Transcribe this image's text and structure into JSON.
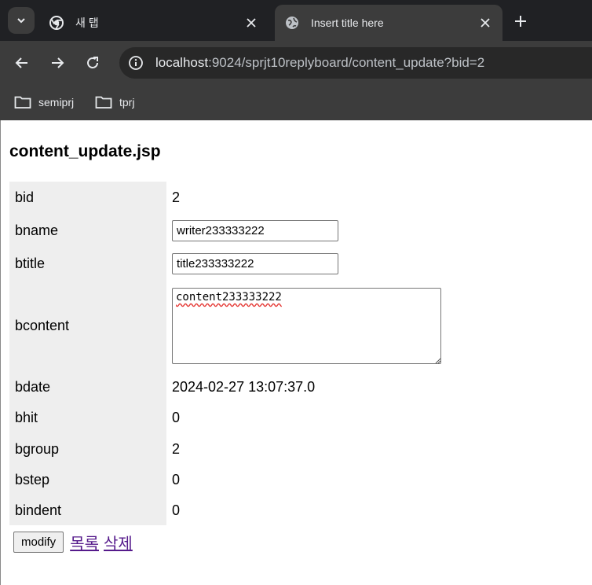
{
  "browser": {
    "tabs": [
      {
        "title": "새 탭",
        "active": false
      },
      {
        "title": "Insert title here",
        "active": true
      }
    ],
    "address": {
      "host": "localhost",
      "rest": ":9024/sprjt10replyboard/content_update?bid=2"
    },
    "bookmarks": [
      {
        "label": "semiprj"
      },
      {
        "label": "tprj"
      }
    ]
  },
  "page": {
    "heading": "content_update.jsp",
    "fields": {
      "bid": {
        "label": "bid",
        "value": "2"
      },
      "bname": {
        "label": "bname",
        "value": "writer233333222"
      },
      "btitle": {
        "label": "btitle",
        "value": "title233333222"
      },
      "bcontent": {
        "label": "bcontent",
        "value": "content233333222"
      },
      "bdate": {
        "label": "bdate",
        "value": "2024-02-27 13:07:37.0"
      },
      "bhit": {
        "label": "bhit",
        "value": "0"
      },
      "bgroup": {
        "label": "bgroup",
        "value": "2"
      },
      "bstep": {
        "label": "bstep",
        "value": "0"
      },
      "bindent": {
        "label": "bindent",
        "value": "0"
      }
    },
    "actions": {
      "modify_label": "modify",
      "list_label": "목록",
      "delete_label": "삭제"
    }
  }
}
